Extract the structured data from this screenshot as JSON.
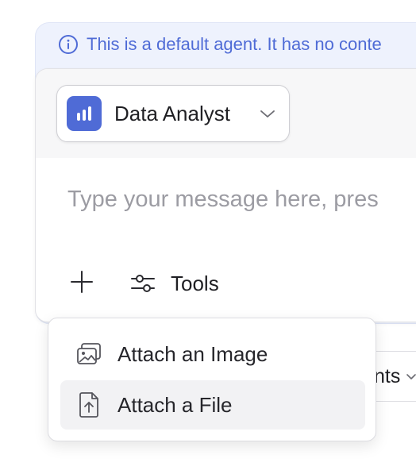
{
  "banner": {
    "text": "This is a default agent. It has no conte",
    "color": "#4f6bd6",
    "icon": "info-icon"
  },
  "agent_selector": {
    "name": "Data Analyst",
    "icon": "bar-chart-icon",
    "accent": "#4f6bd6"
  },
  "composer": {
    "placeholder": "Type your message here, pres",
    "value": ""
  },
  "toolbar": {
    "add_icon": "plus-icon",
    "tools_label": "Tools",
    "tools_icon": "sliders-icon"
  },
  "behind_control": {
    "label": "nts"
  },
  "attach_menu": {
    "items": [
      {
        "label": "Attach an Image",
        "icon": "image-icon"
      },
      {
        "label": "Attach a File",
        "icon": "file-upload-icon",
        "highlighted": true
      }
    ]
  }
}
